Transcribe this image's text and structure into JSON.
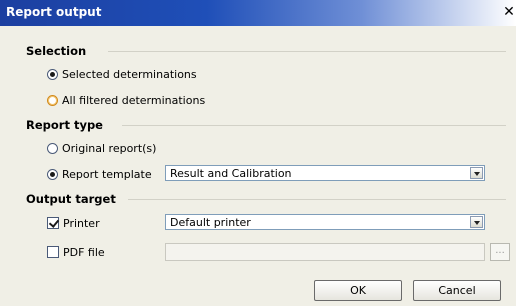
{
  "window": {
    "title": "Report output",
    "close_glyph": "✕"
  },
  "selection": {
    "heading": "Selection",
    "options": [
      {
        "label": "Selected determinations",
        "checked": true
      },
      {
        "label": "All filtered determinations",
        "checked": false
      }
    ]
  },
  "report_type": {
    "heading": "Report type",
    "original_label": "Original report(s)",
    "template_label": "Report template",
    "template_value": "Result and Calibration"
  },
  "output_target": {
    "heading": "Output target",
    "printer_label": "Printer",
    "printer_checked": true,
    "printer_value": "Default printer",
    "pdf_label": "PDF file",
    "pdf_checked": false,
    "pdf_path": "",
    "browse_label": "..."
  },
  "buttons": {
    "ok": "OK",
    "cancel": "Cancel"
  },
  "icons": {
    "close": "close-icon",
    "dropdown": "chevron-down-icon"
  }
}
